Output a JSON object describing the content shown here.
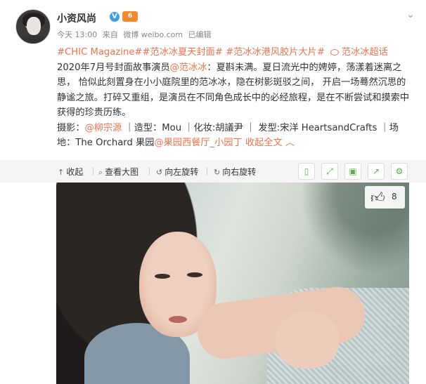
{
  "post": {
    "username": "小资风尚",
    "verified_icon": "verified-v-icon",
    "level_icon": "vip-badge-icon",
    "time": "今天 13:00",
    "source_prefix": "来自",
    "source": "微博 weibo.com",
    "edited": "已编辑"
  },
  "content": {
    "topic1": "#CHIC Magazine#",
    "topic2": "#范冰冰夏天封面#",
    "topic3": "#范冰冰港风胶片大片#",
    "super_topic": "范冰冰超话",
    "body_prefix": "2020年7月号封面故事演员",
    "mention_star": "@范冰冰",
    "body_text": "：夏斟未满。夏日流光中的娉婷，荡漾着迷离之思， 恰似此刻置身在小小庭院里的范冰冰，隐在树影斑驳之间， 开启一场蓦然沉思的静谧之旅。打碎又重组，是演员在不同角色成长中的必经旅程，是在不断尝试和摸索中获得的珍贵历练。",
    "credits_photo_label": "摄影：",
    "credits_photo": "@柳宗源",
    "credits_rest": " ｜造型：Mou ｜化妆:胡議尹 ｜ 发型:宋洋 HeartsandCrafts ｜场地：The Orchard 果园",
    "mention_place": "@果园西餐厅_小园丁",
    "collapse": "收起全文",
    "collapse_icon": "^"
  },
  "media_toolbar": {
    "collapse": "收起",
    "view_large": "查看大图",
    "rotate_left": "向左旋转",
    "rotate_right": "向右旋转"
  },
  "like": {
    "count": "8"
  }
}
